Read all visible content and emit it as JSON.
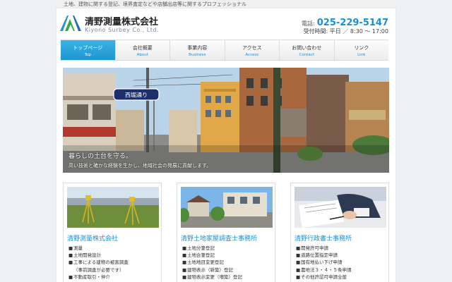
{
  "tagline": "土地、建物に関する登記、境界査定などや店舗出店等に関するプロフェッショナル",
  "header": {
    "company_name": "清野測量株式会社",
    "company_name_en": "Kiyono Surbey Co., Ltd.",
    "tel_label": "電話:",
    "tel_number": "025-229-5147",
    "hours": "受付時間: 平日 ／ 8:30 〜 17:00"
  },
  "nav": [
    {
      "label": "トップページ",
      "sub": "Top",
      "active": true
    },
    {
      "label": "会社概要",
      "sub": "About"
    },
    {
      "label": "事業内容",
      "sub": "Business"
    },
    {
      "label": "アクセス",
      "sub": "Access"
    },
    {
      "label": "お問い合わせ",
      "sub": "Contact"
    },
    {
      "label": "リンク",
      "sub": "Link"
    }
  ],
  "hero": {
    "title": "暮らしの土台を守る。",
    "subtitle": "高い技術と確かな経験を生かし、地域社会の発展に貢献します。",
    "street_sign": "西堀通り"
  },
  "cards": [
    {
      "title": "清野測量株式会社",
      "items": [
        "測量",
        "土地開発設計",
        "工事による建物の被害調査",
        "（事前調査が必要です）",
        "不動産取引・仲介"
      ],
      "bullets": [
        true,
        true,
        true,
        false,
        true
      ]
    },
    {
      "title": "清野土地家屋調査士事務所",
      "items": [
        "土地分筆登記",
        "土地合筆登記",
        "土地地目変更登記",
        "建物表示（新築）登記",
        "建物表示変更（増築）登記"
      ],
      "bullets": [
        true,
        true,
        true,
        true,
        true
      ]
    },
    {
      "title": "清野行政書士事務所",
      "items": [
        "開発許可申請",
        "道路位置指定申請",
        "国有地払い下げ申請",
        "農地法３・４・５条申請",
        "その他許認可申請全般"
      ],
      "bullets": [
        true,
        true,
        true,
        true,
        true
      ]
    }
  ],
  "colors": {
    "accent": "#1a8fd6",
    "nav_active": "#2aa4de",
    "background": "#eef0f2"
  }
}
